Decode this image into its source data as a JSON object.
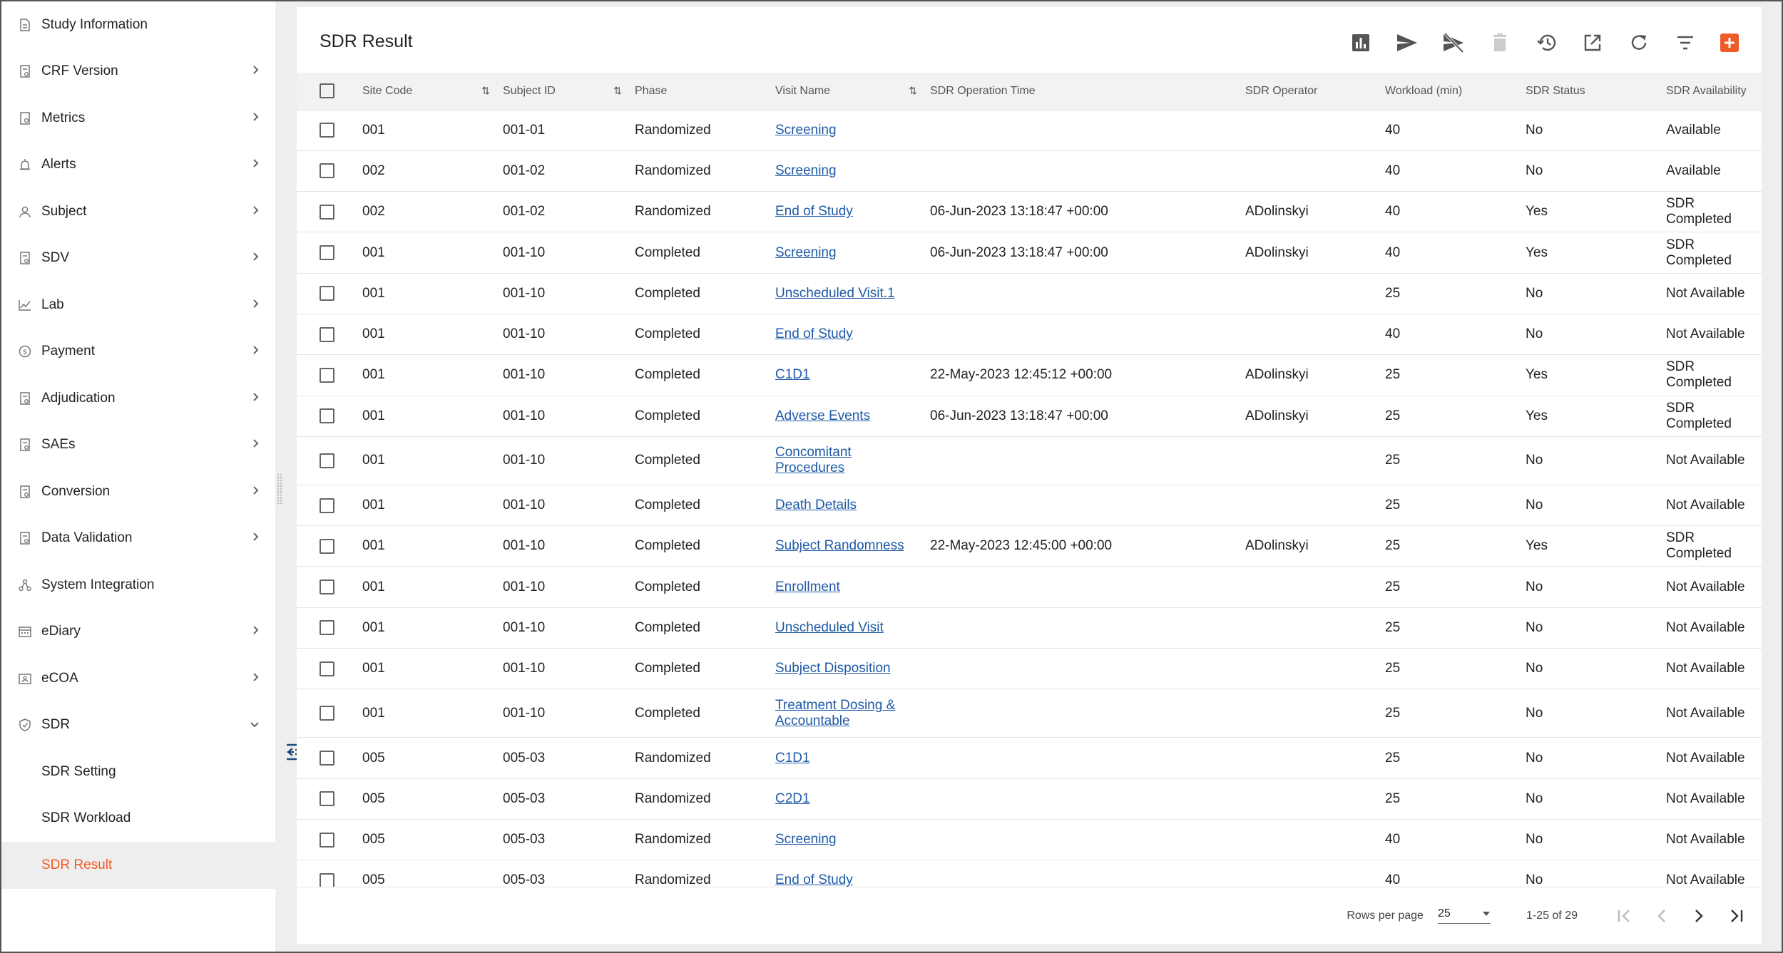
{
  "sidebar": {
    "items": [
      {
        "label": "Study Information",
        "icon": "document-icon",
        "chevron": ""
      },
      {
        "label": "CRF Version",
        "icon": "form-icon",
        "chevron": "right"
      },
      {
        "label": "Metrics",
        "icon": "metrics-icon",
        "chevron": "right"
      },
      {
        "label": "Alerts",
        "icon": "alarm-icon",
        "chevron": "right"
      },
      {
        "label": "Subject",
        "icon": "person-icon",
        "chevron": "right"
      },
      {
        "label": "SDV",
        "icon": "form-icon",
        "chevron": "right"
      },
      {
        "label": "Lab",
        "icon": "chart-line-icon",
        "chevron": "right"
      },
      {
        "label": "Payment",
        "icon": "payment-icon",
        "chevron": "right"
      },
      {
        "label": "Adjudication",
        "icon": "form-icon",
        "chevron": "right"
      },
      {
        "label": "SAEs",
        "icon": "form-icon",
        "chevron": "right"
      },
      {
        "label": "Conversion",
        "icon": "form-icon",
        "chevron": "right"
      },
      {
        "label": "Data Validation",
        "icon": "form-icon",
        "chevron": "right"
      },
      {
        "label": "System Integration",
        "icon": "network-icon",
        "chevron": ""
      },
      {
        "label": "eDiary",
        "icon": "calendar-icon",
        "chevron": "right"
      },
      {
        "label": "eCOA",
        "icon": "badge-icon",
        "chevron": "right"
      },
      {
        "label": "SDR",
        "icon": "shield-icon",
        "chevron": "down"
      }
    ],
    "sub_items": [
      {
        "label": "SDR Setting",
        "active": false
      },
      {
        "label": "SDR Workload",
        "active": false
      },
      {
        "label": "SDR Result",
        "active": true
      }
    ]
  },
  "page": {
    "title": "SDR Result",
    "toolbar": [
      "bar-chart-icon",
      "send-icon",
      "unsend-icon",
      "delete-icon",
      "history-icon",
      "open-external-icon",
      "refresh-icon",
      "filter-icon",
      "add-icon"
    ]
  },
  "table": {
    "headers": [
      "Site Code",
      "Subject ID",
      "Phase",
      "Visit Name",
      "SDR Operation Time",
      "SDR Operator",
      "Workload (min)",
      "SDR Status",
      "SDR Availability"
    ],
    "rows": [
      [
        "001",
        "001-01",
        "Randomized",
        "Screening",
        "",
        "",
        "40",
        "No",
        "Available"
      ],
      [
        "002",
        "001-02",
        "Randomized",
        "Screening",
        "",
        "",
        "40",
        "No",
        "Available"
      ],
      [
        "002",
        "001-02",
        "Randomized",
        "End of Study",
        "06-Jun-2023 13:18:47 +00:00",
        "ADolinskyi",
        "40",
        "Yes",
        "SDR Completed"
      ],
      [
        "001",
        "001-10",
        "Completed",
        "Screening",
        "06-Jun-2023 13:18:47 +00:00",
        "ADolinskyi",
        "40",
        "Yes",
        "SDR Completed"
      ],
      [
        "001",
        "001-10",
        "Completed",
        "Unscheduled Visit.1",
        "",
        "",
        "25",
        "No",
        "Not Available"
      ],
      [
        "001",
        "001-10",
        "Completed",
        "End of Study",
        "",
        "",
        "40",
        "No",
        "Not Available"
      ],
      [
        "001",
        "001-10",
        "Completed",
        "C1D1",
        "22-May-2023 12:45:12 +00:00",
        "ADolinskyi",
        "25",
        "Yes",
        "SDR Completed"
      ],
      [
        "001",
        "001-10",
        "Completed",
        "Adverse Events",
        "06-Jun-2023 13:18:47 +00:00",
        "ADolinskyi",
        "25",
        "Yes",
        "SDR Completed"
      ],
      [
        "001",
        "001-10",
        "Completed",
        "Concomitant Procedures",
        "",
        "",
        "25",
        "No",
        "Not Available"
      ],
      [
        "001",
        "001-10",
        "Completed",
        "Death Details",
        "",
        "",
        "25",
        "No",
        "Not Available"
      ],
      [
        "001",
        "001-10",
        "Completed",
        "Subject Randomness",
        "22-May-2023 12:45:00 +00:00",
        "ADolinskyi",
        "25",
        "Yes",
        "SDR Completed"
      ],
      [
        "001",
        "001-10",
        "Completed",
        "Enrollment",
        "",
        "",
        "25",
        "No",
        "Not Available"
      ],
      [
        "001",
        "001-10",
        "Completed",
        "Unscheduled Visit",
        "",
        "",
        "25",
        "No",
        "Not Available"
      ],
      [
        "001",
        "001-10",
        "Completed",
        "Subject Disposition",
        "",
        "",
        "25",
        "No",
        "Not Available"
      ],
      [
        "001",
        "001-10",
        "Completed",
        "Treatment Dosing & Accountable",
        "",
        "",
        "25",
        "No",
        "Not Available"
      ],
      [
        "005",
        "005-03",
        "Randomized",
        "C1D1",
        "",
        "",
        "25",
        "No",
        "Not Available"
      ],
      [
        "005",
        "005-03",
        "Randomized",
        "C2D1",
        "",
        "",
        "25",
        "No",
        "Not Available"
      ],
      [
        "005",
        "005-03",
        "Randomized",
        "Screening",
        "",
        "",
        "40",
        "No",
        "Not Available"
      ],
      [
        "005",
        "005-03",
        "Randomized",
        "End of Study",
        "",
        "",
        "40",
        "No",
        "Not Available"
      ]
    ]
  },
  "pagination": {
    "rows_per_page_label": "Rows per page",
    "rows_per_page_value": "25",
    "range_text": "1-25 of 29"
  },
  "colors": {
    "accent": "#f05a28",
    "link": "#1f5aa6"
  }
}
